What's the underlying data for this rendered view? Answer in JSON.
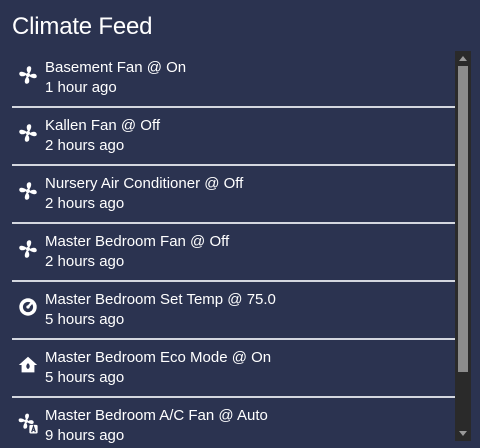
{
  "header": {
    "title": "Climate Feed"
  },
  "feed": {
    "items": [
      {
        "icon": "fan-icon",
        "name": "Basement Fan @ On",
        "time": "1 hour ago"
      },
      {
        "icon": "fan-icon",
        "name": "Kallen Fan @ Off",
        "time": "2 hours ago"
      },
      {
        "icon": "fan-icon",
        "name": "Nursery Air Conditioner @ Off",
        "time": "2 hours ago"
      },
      {
        "icon": "fan-icon",
        "name": "Master Bedroom Fan @ Off",
        "time": "2 hours ago"
      },
      {
        "icon": "thermostat-icon",
        "name": "Master Bedroom Set Temp @ 75.0",
        "time": "5 hours ago"
      },
      {
        "icon": "eco-home-icon",
        "name": "Master Bedroom Eco Mode @ On",
        "time": "5 hours ago"
      },
      {
        "icon": "fan-auto-icon",
        "name": "Master Bedroom A/C Fan @ Auto",
        "time": "9 hours ago"
      }
    ]
  },
  "colors": {
    "background": "#2b3350",
    "divider": "#d4d7df",
    "text": "#ffffff",
    "scroll_track": "#2a2a2a",
    "scroll_thumb": "#8c8c8c"
  }
}
